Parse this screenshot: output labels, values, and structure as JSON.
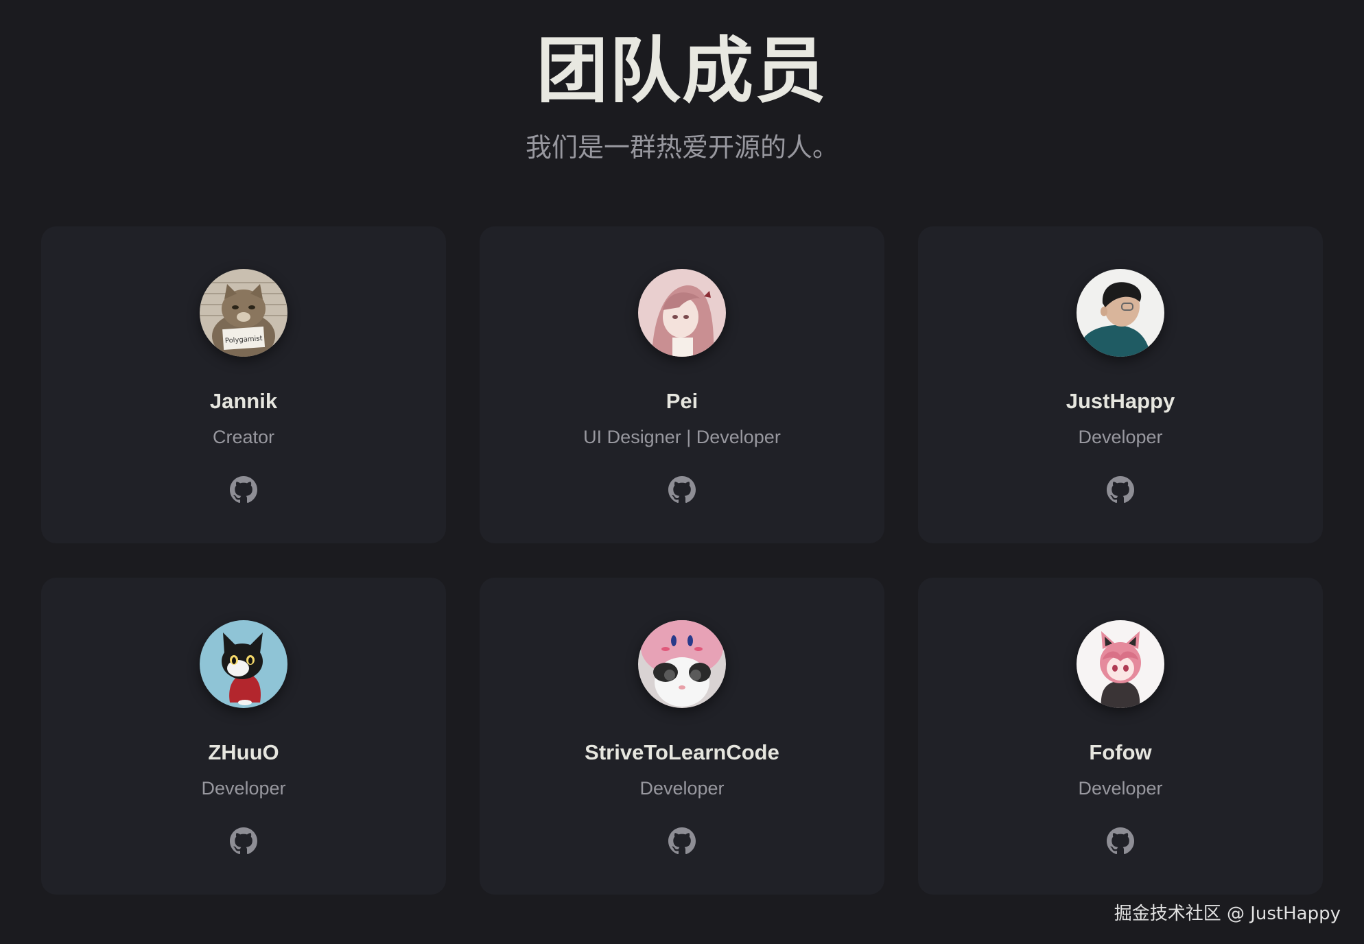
{
  "page": {
    "title": "团队成员",
    "subtitle": "我们是一群热爱开源的人。"
  },
  "members": [
    {
      "name": "Jannik",
      "role": "Creator",
      "avatar_icon": "cat-mugshot-avatar",
      "avatar_sign_text": "Polygamist",
      "link_icon": "github-icon"
    },
    {
      "name": "Pei",
      "role": "UI Designer | Developer",
      "avatar_icon": "anime-girl-avatar",
      "link_icon": "github-icon"
    },
    {
      "name": "JustHappy",
      "role": "Developer",
      "avatar_icon": "person-photo-avatar",
      "link_icon": "github-icon"
    },
    {
      "name": "ZHuuO",
      "role": "Developer",
      "avatar_icon": "cartoon-cat-avatar",
      "link_icon": "github-icon"
    },
    {
      "name": "StriveToLearnCode",
      "role": "Developer",
      "avatar_icon": "cat-in-pink-hat-avatar",
      "link_icon": "github-icon"
    },
    {
      "name": "Fofow",
      "role": "Developer",
      "avatar_icon": "anime-catgirl-avatar",
      "link_icon": "github-icon"
    }
  ],
  "watermark": "掘金技术社区 @ JustHappy",
  "colors": {
    "background": "#1b1b1f",
    "card": "#202127",
    "text_primary": "#e6e6df",
    "text_secondary": "#98989f",
    "icon": "#8e8e95"
  }
}
